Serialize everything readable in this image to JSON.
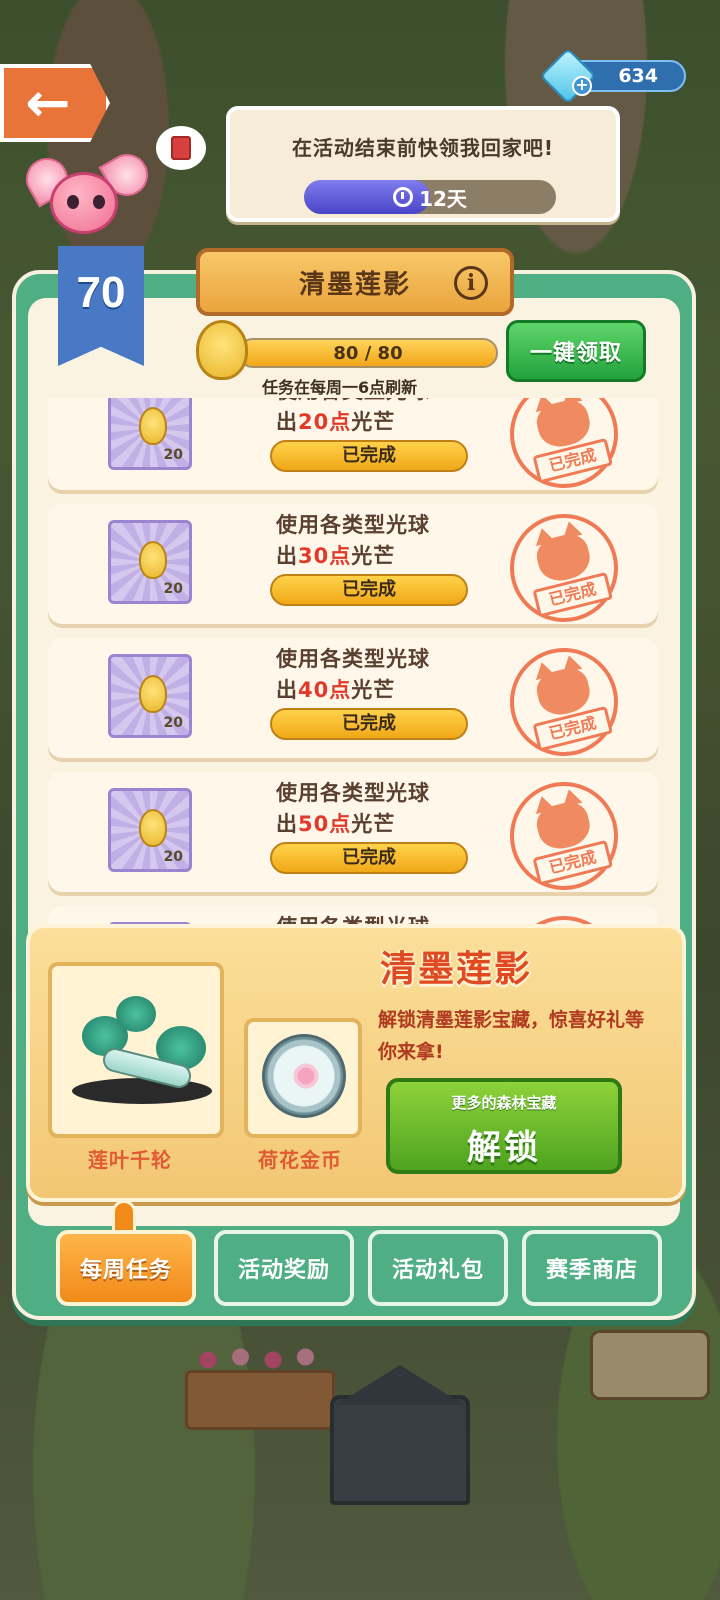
{
  "header": {
    "currency_value": "634",
    "speech_text": "在活动结束前快领我回家吧!",
    "timer_label": "12天",
    "timer_fill_fraction": 0.5
  },
  "panel": {
    "level": "70",
    "title": "清墨莲影",
    "info_glyph": "i",
    "progress_label": "80 / 80",
    "progress_fraction": 1.0,
    "refresh_note": "任务在每周一6点刷新",
    "claim_all_label": "一键领取"
  },
  "tasks": [
    {
      "line1": "使用各类型光球",
      "line2_prefix": "出",
      "line2_highlight": "20点",
      "line2_suffix": "光芒",
      "reward_qty": "20",
      "status": "已完成",
      "stamp": "已完成"
    },
    {
      "line1": "使用各类型光球",
      "line2_prefix": "出",
      "line2_highlight": "30点",
      "line2_suffix": "光芒",
      "reward_qty": "20",
      "status": "已完成",
      "stamp": "已完成"
    },
    {
      "line1": "使用各类型光球",
      "line2_prefix": "出",
      "line2_highlight": "40点",
      "line2_suffix": "光芒",
      "reward_qty": "20",
      "status": "已完成",
      "stamp": "已完成"
    },
    {
      "line1": "使用各类型光球",
      "line2_prefix": "出",
      "line2_highlight": "50点",
      "line2_suffix": "光芒",
      "reward_qty": "20",
      "status": "已完成",
      "stamp": "已完成"
    },
    {
      "line1": "使用各类型光球",
      "line2_prefix": "",
      "line2_highlight": "",
      "line2_suffix": "",
      "reward_qty": "",
      "status": "",
      "stamp": ""
    }
  ],
  "treasure": {
    "title": "清墨莲影",
    "description": "解锁清墨莲影宝藏，惊喜好礼等你来拿!",
    "item1_label": "莲叶千轮",
    "item2_label": "荷花金币",
    "unlock_sub": "更多的森林宝藏",
    "unlock_main": "解锁"
  },
  "tabs": [
    {
      "label": "每周任务",
      "active": true
    },
    {
      "label": "活动奖励",
      "active": false
    },
    {
      "label": "活动礼包",
      "active": false
    },
    {
      "label": "赛季商店",
      "active": false
    }
  ],
  "icons": {
    "back": "back-arrow-icon",
    "gem": "gem-icon",
    "book": "book-icon",
    "clock": "clock-icon",
    "info": "info-icon",
    "chick": "chick-token-icon",
    "stamp": "cat-stamp-icon"
  },
  "colors": {
    "panel_green": "#4fae84",
    "accent_orange": "#f08a18",
    "highlight_red": "#e23a2a",
    "claim_green": "#22a23c"
  }
}
